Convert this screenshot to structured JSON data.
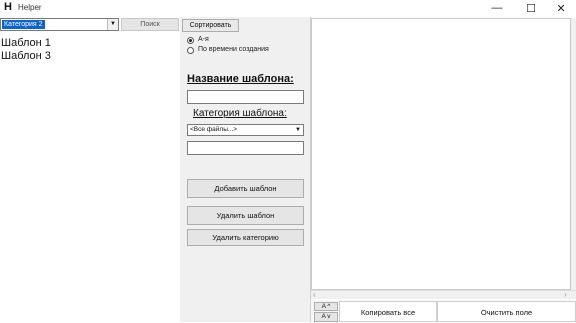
{
  "window": {
    "icon_letter": "H",
    "title": "Helper",
    "minimize_glyph": "—",
    "maximize_glyph": "☐",
    "close_glyph": "✕"
  },
  "left": {
    "category_select_value": "Категория 2",
    "search_label": "Поиск",
    "templates": [
      "Шаблон 1",
      "Шаблон 3"
    ]
  },
  "middle": {
    "sort_label": "Сортировать",
    "sort_options": [
      {
        "label": "А-я",
        "selected": true
      },
      {
        "label": "По времени создания",
        "selected": false
      }
    ],
    "name_label": "Название шаблона:",
    "name_value": "",
    "category_label": "Категория шаблона:",
    "category_value": "<Все файлы...>",
    "new_category_value": "",
    "buttons": {
      "add": "Добавить шаблон",
      "delete": "Удалить шаблон",
      "delete_category": "Удалить категорию"
    }
  },
  "right": {
    "editor_text": "",
    "font_up_label": "A ^",
    "font_down_label": "A v",
    "copy_all_label": "Копировать все",
    "clear_label": "Очистить поле"
  },
  "colors": {
    "selection": "#0a64d4",
    "panel": "#f0f0f0",
    "button": "#e5e5e5"
  }
}
